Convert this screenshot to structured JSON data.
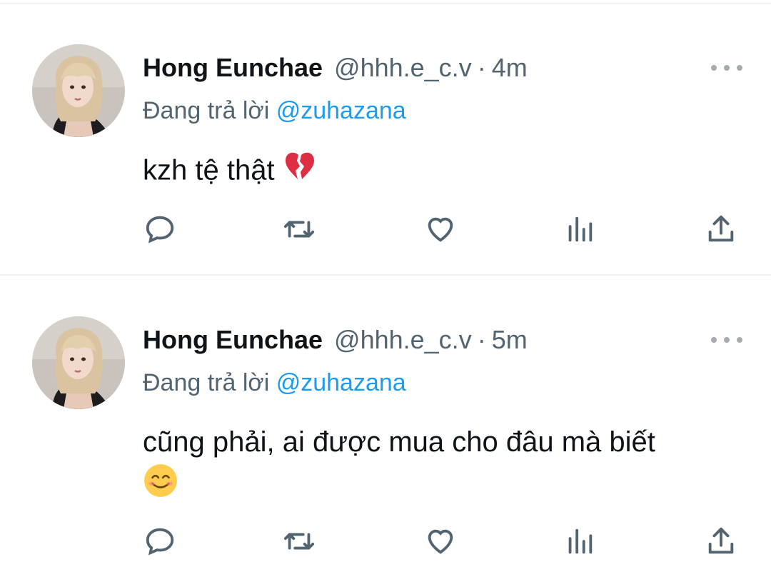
{
  "tweets": [
    {
      "name": "Hong Eunchae",
      "handle": "@hhh.e_c.v",
      "separator": "·",
      "time": "4m",
      "reply_prefix": "Đang trả lời",
      "reply_to": "@zuhazana",
      "text": "kzh tệ thật",
      "emoji": "broken-heart-icon"
    },
    {
      "name": "Hong Eunchae",
      "handle": "@hhh.e_c.v",
      "separator": "·",
      "time": "5m",
      "reply_prefix": "Đang trả lời",
      "reply_to": "@zuhazana",
      "text": "cũng phải, ai được mua cho đâu mà biết",
      "emoji": "smiling-face-icon"
    }
  ],
  "colors": {
    "text": "#0f1419",
    "secondary": "#536471",
    "mention": "#1d9bf0",
    "divider": "#eff3f4",
    "icon": "#536471"
  }
}
